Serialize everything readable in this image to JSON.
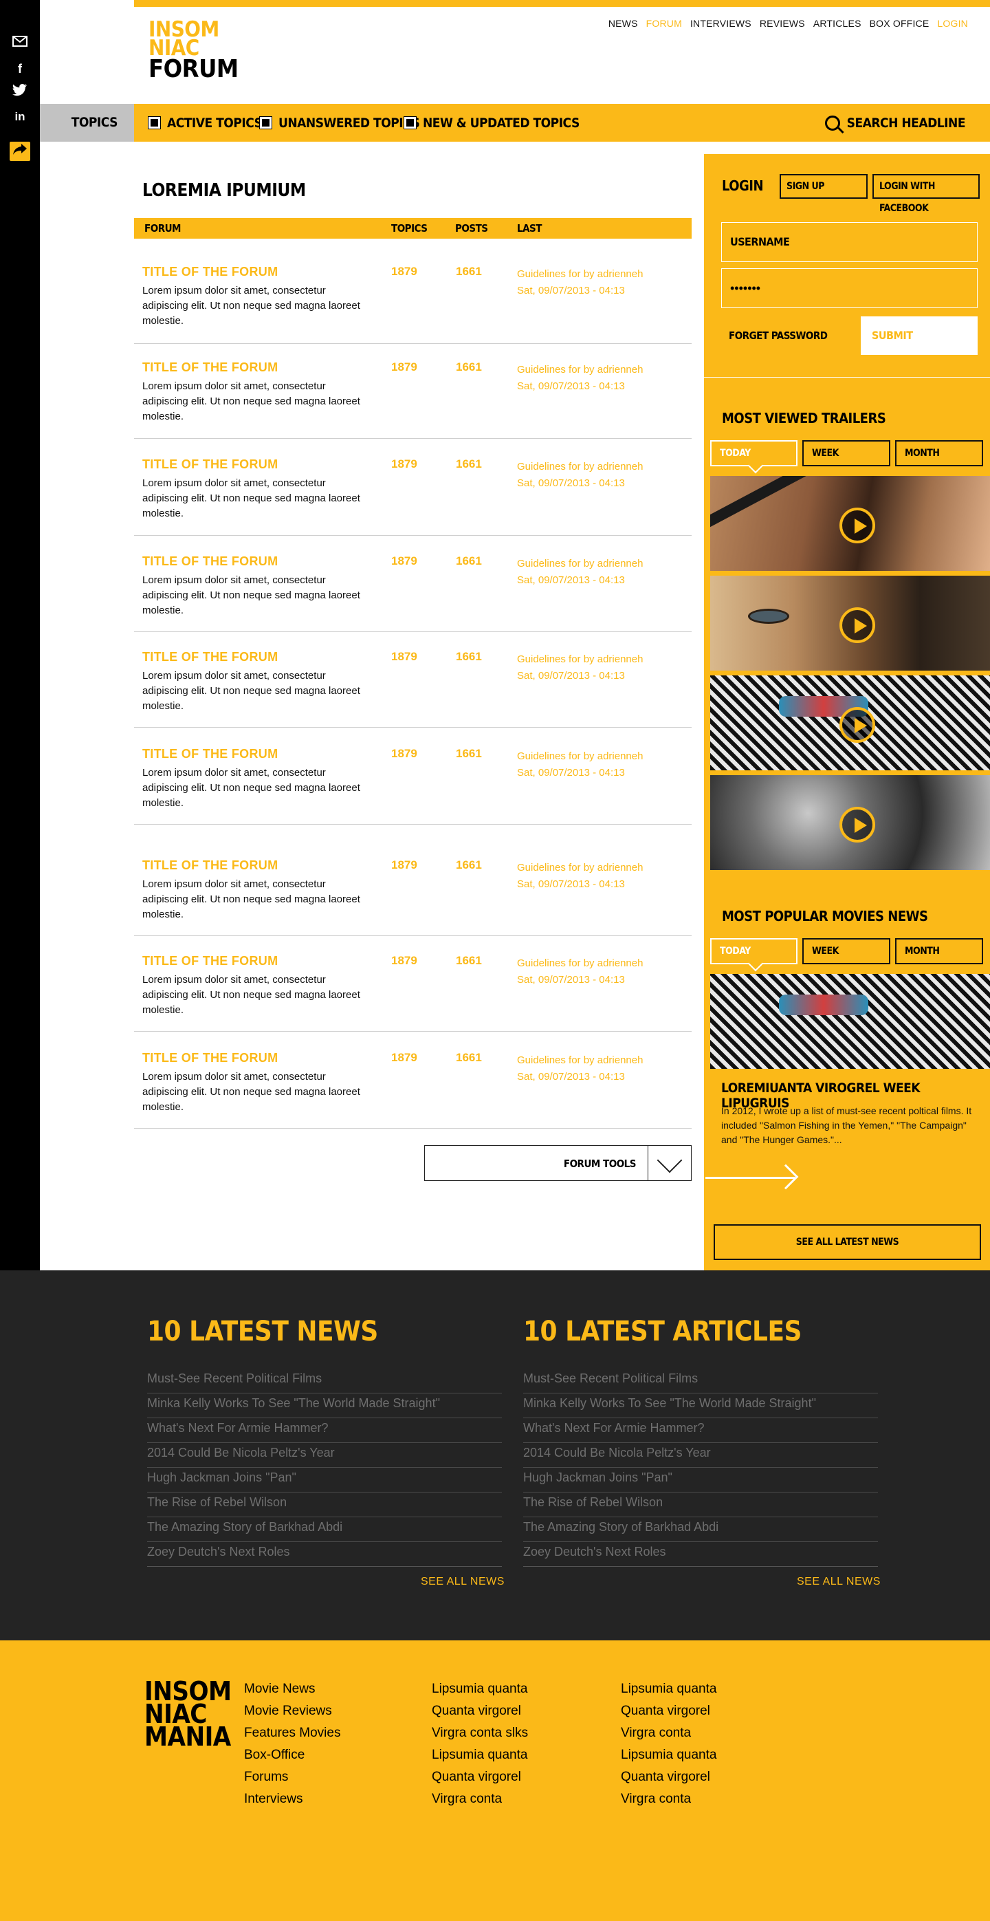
{
  "social": {
    "icons": [
      "mail-icon",
      "facebook-icon",
      "twitter-icon",
      "linkedin-icon",
      "share-icon"
    ]
  },
  "header": {
    "logo_line1": "INSOM",
    "logo_line2": "NIAC",
    "logo_line3": "FORUM",
    "nav": [
      "NEWS",
      "FORUM",
      "INTERVIEWS",
      "REVIEWS",
      "ARTICLES",
      "BOX OFFICE",
      "LOGIN"
    ]
  },
  "topics": {
    "label": "TOPICS",
    "items": [
      "ACTIVE TOPICS",
      "UNANSWERED TOPICS",
      "NEW & UPDATED TOPICS"
    ],
    "search": "SEARCH HEADLINE"
  },
  "forum": {
    "title": "LOREMIA IPUMIUM",
    "columns": [
      "FORUM",
      "TOPICS",
      "POSTS",
      "LAST"
    ],
    "rows": [
      {
        "title": "TITLE OF THE FORUM",
        "desc": "Lorem ipsum dolor sit amet, consectetur adipiscing elit. Ut non neque sed magna laoreet molestie.",
        "topics": "1879",
        "posts": "1661",
        "last1": "Guidelines for by adrienneh",
        "last2": "Sat, 09/07/2013 - 04:13"
      },
      {
        "title": "TITLE OF THE FORUM",
        "desc": "Lorem ipsum dolor sit amet, consectetur adipiscing elit. Ut non neque sed magna laoreet molestie.",
        "topics": "1879",
        "posts": "1661",
        "last1": "Guidelines for by adrienneh",
        "last2": "Sat, 09/07/2013 - 04:13"
      },
      {
        "title": "TITLE OF THE FORUM",
        "desc": "Lorem ipsum dolor sit amet, consectetur adipiscing elit. Ut non neque sed magna laoreet molestie.",
        "topics": "1879",
        "posts": "1661",
        "last1": "Guidelines for by adrienneh",
        "last2": "Sat, 09/07/2013 - 04:13"
      },
      {
        "title": "TITLE OF THE FORUM",
        "desc": "Lorem ipsum dolor sit amet, consectetur adipiscing elit. Ut non neque sed magna laoreet molestie.",
        "topics": "1879",
        "posts": "1661",
        "last1": "Guidelines for by adrienneh",
        "last2": "Sat, 09/07/2013 - 04:13"
      },
      {
        "title": "TITLE OF THE FORUM",
        "desc": "Lorem ipsum dolor sit amet, consectetur adipiscing elit. Ut non neque sed magna laoreet molestie.",
        "topics": "1879",
        "posts": "1661",
        "last1": "Guidelines for by adrienneh",
        "last2": "Sat, 09/07/2013 - 04:13"
      },
      {
        "title": "TITLE OF THE FORUM",
        "desc": "Lorem ipsum dolor sit amet, consectetur adipiscing elit. Ut non neque sed magna laoreet molestie.",
        "topics": "1879",
        "posts": "1661",
        "last1": "Guidelines for by adrienneh",
        "last2": "Sat, 09/07/2013 - 04:13"
      },
      {
        "title": "TITLE OF THE FORUM",
        "desc": "Lorem ipsum dolor sit amet, consectetur adipiscing elit. Ut non neque sed magna laoreet molestie.",
        "topics": "1879",
        "posts": "1661",
        "last1": "Guidelines for by adrienneh",
        "last2": "Sat, 09/07/2013 - 04:13"
      },
      {
        "title": "TITLE OF THE FORUM",
        "desc": "Lorem ipsum dolor sit amet, consectetur adipiscing elit. Ut non neque sed magna laoreet molestie.",
        "topics": "1879",
        "posts": "1661",
        "last1": "Guidelines for by adrienneh",
        "last2": "Sat, 09/07/2013 - 04:13"
      },
      {
        "title": "TITLE OF THE FORUM",
        "desc": "Lorem ipsum dolor sit amet, consectetur adipiscing elit. Ut non neque sed magna laoreet molestie.",
        "topics": "1879",
        "posts": "1661",
        "last1": "Guidelines for by adrienneh",
        "last2": "Sat, 09/07/2013 - 04:13"
      }
    ],
    "tools_label": "FORUM TOOLS"
  },
  "sidebar": {
    "login_title": "LOGIN",
    "signup": "SIGN UP",
    "login_facebook": "LOGIN WITH FACEBOOK",
    "username_placeholder": "USERNAME",
    "password_value": "•••••••",
    "forgot": "FORGET PASSWORD",
    "submit": "SUBMIT",
    "trailers_title": "MOST VIEWED TRAILERS",
    "tabs": [
      "TODAY",
      "WEEK",
      "MONTH"
    ],
    "news_title": "MOST POPULAR MOVIES NEWS",
    "news_headline": "LOREMIUANTA VIROGREL WEEK LIPUGRUIS",
    "news_text": "In 2012, I wrote up a list of must-see recent poltical films. It included \"Salmon Fishing in the Yemen,\" \"The Campaign\" and \"The Hunger Games.\"...",
    "see_all": "SEE ALL LATEST NEWS"
  },
  "latest": {
    "news_title": "10 LATEST NEWS",
    "articles_title": "10 LATEST ARTICLES",
    "news": [
      "Must-See Recent Political Films",
      "Minka Kelly Works To See \"The World Made Straight\"",
      "What's Next For Armie Hammer?",
      "2014 Could Be Nicola Peltz's Year",
      "Hugh Jackman Joins \"Pan\"",
      "The Rise of Rebel Wilson",
      "The Amazing Story of Barkhad Abdi",
      "Zoey Deutch's Next Roles"
    ],
    "articles": [
      "Must-See Recent Political Films",
      "Minka Kelly Works To See \"The World Made Straight\"",
      "What's Next For Armie Hammer?",
      "2014 Could Be Nicola Peltz's Year",
      "Hugh Jackman Joins \"Pan\"",
      "The Rise of Rebel Wilson",
      "The Amazing Story of Barkhad Abdi",
      "Zoey Deutch's Next Roles"
    ],
    "see_all": "SEE ALL NEWS"
  },
  "footer": {
    "logo_line1": "INSOM",
    "logo_line2": "NIAC",
    "logo_line3": "MANIA",
    "col1": [
      "Movie News",
      "Movie Reviews",
      "Features Movies",
      "Box-Office",
      "Forums",
      "Interviews"
    ],
    "col2": [
      "Lipsumia quanta",
      "Quanta virgorel",
      "Virgra conta slks",
      "Lipsumia quanta",
      "Quanta virgorel",
      "Virgra conta"
    ],
    "col3": [
      "Lipsumia quanta",
      "Quanta virgorel",
      "Virgra conta",
      "Lipsumia quanta",
      "Quanta virgorel",
      "Virgra conta"
    ]
  },
  "colors": {
    "accent": "#fbb918",
    "dark": "#242424",
    "black": "#000000"
  }
}
